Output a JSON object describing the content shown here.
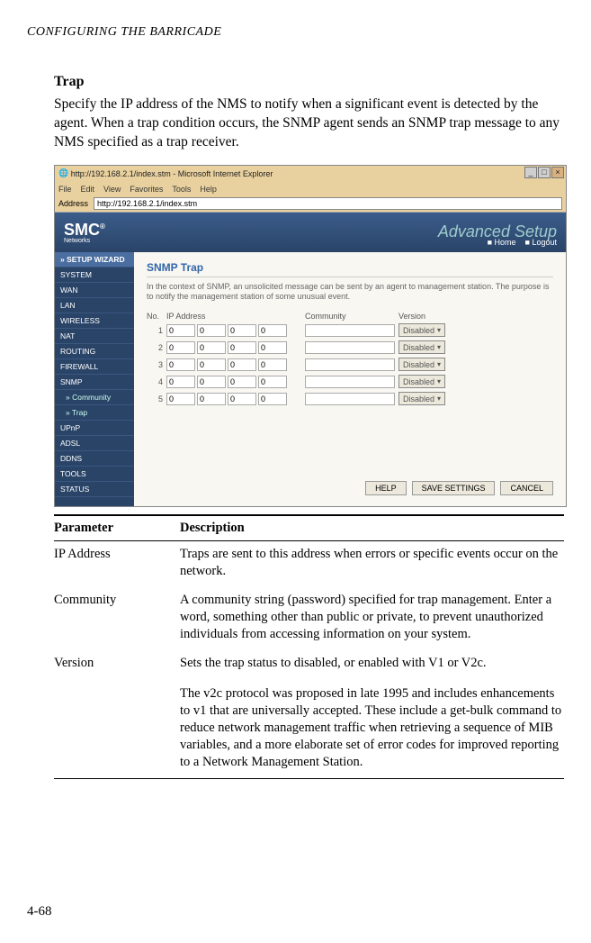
{
  "running_head": "CONFIGURING THE BARRICADE",
  "section_title": "Trap",
  "intro_para": "Specify the IP address of the NMS to notify when a significant event is detected by the agent. When a trap condition occurs, the SNMP agent sends an SNMP trap message to any NMS specified as a trap receiver.",
  "page_number": "4-68",
  "shot": {
    "window_title": "http://192.168.2.1/index.stm - Microsoft Internet Explorer",
    "menu": [
      "File",
      "Edit",
      "View",
      "Favorites",
      "Tools",
      "Help"
    ],
    "address_label": "Address",
    "address_value": "http://192.168.2.1/index.stm",
    "logo": "SMC",
    "logo_sub": "Networks",
    "banner_text": "Advanced Setup",
    "home_link": "Home",
    "logout_link": "Logout",
    "sidebar": {
      "wizard": "» SETUP WIZARD",
      "items": [
        "SYSTEM",
        "WAN",
        "LAN",
        "WIRELESS",
        "NAT",
        "ROUTING",
        "FIREWALL",
        "SNMP"
      ],
      "snmp_sub": [
        "» Community",
        "» Trap"
      ],
      "items2": [
        "UPnP",
        "ADSL",
        "DDNS",
        "TOOLS",
        "STATUS"
      ]
    },
    "panel_title": "SNMP Trap",
    "panel_desc": "In the context of SNMP, an unsolicited message can be sent by an agent to management station. The purpose is to notify the management station of some unusual event.",
    "headers": {
      "no": "No.",
      "ip": "IP Address",
      "community": "Community",
      "version": "Version"
    },
    "rows": [
      {
        "n": "1",
        "ip": [
          "0",
          "0",
          "0",
          "0"
        ],
        "community": "",
        "version": "Disabled"
      },
      {
        "n": "2",
        "ip": [
          "0",
          "0",
          "0",
          "0"
        ],
        "community": "",
        "version": "Disabled"
      },
      {
        "n": "3",
        "ip": [
          "0",
          "0",
          "0",
          "0"
        ],
        "community": "",
        "version": "Disabled"
      },
      {
        "n": "4",
        "ip": [
          "0",
          "0",
          "0",
          "0"
        ],
        "community": "",
        "version": "Disabled"
      },
      {
        "n": "5",
        "ip": [
          "0",
          "0",
          "0",
          "0"
        ],
        "community": "",
        "version": "Disabled"
      }
    ],
    "buttons": {
      "help": "HELP",
      "save": "SAVE SETTINGS",
      "cancel": "CANCEL"
    }
  },
  "ptable": {
    "col1": "Parameter",
    "col2": "Description",
    "rows": [
      {
        "p": "IP Address",
        "d": "Traps are sent to this address when errors or specific events occur on the network."
      },
      {
        "p": "Community",
        "d": "A community string (password) specified for trap management. Enter a word, something other than public or private, to prevent unauthorized individuals from accessing information on your system."
      },
      {
        "p": "Version",
        "d": "Sets the trap status to disabled, or enabled with V1 or V2c."
      }
    ],
    "extra": "The v2c protocol was proposed in late 1995 and includes enhancements to v1 that are universally accepted. These include a get-bulk command to reduce network management traffic when retrieving a sequence of MIB variables, and a more elaborate set of error codes for improved reporting to a Network Management Station."
  }
}
